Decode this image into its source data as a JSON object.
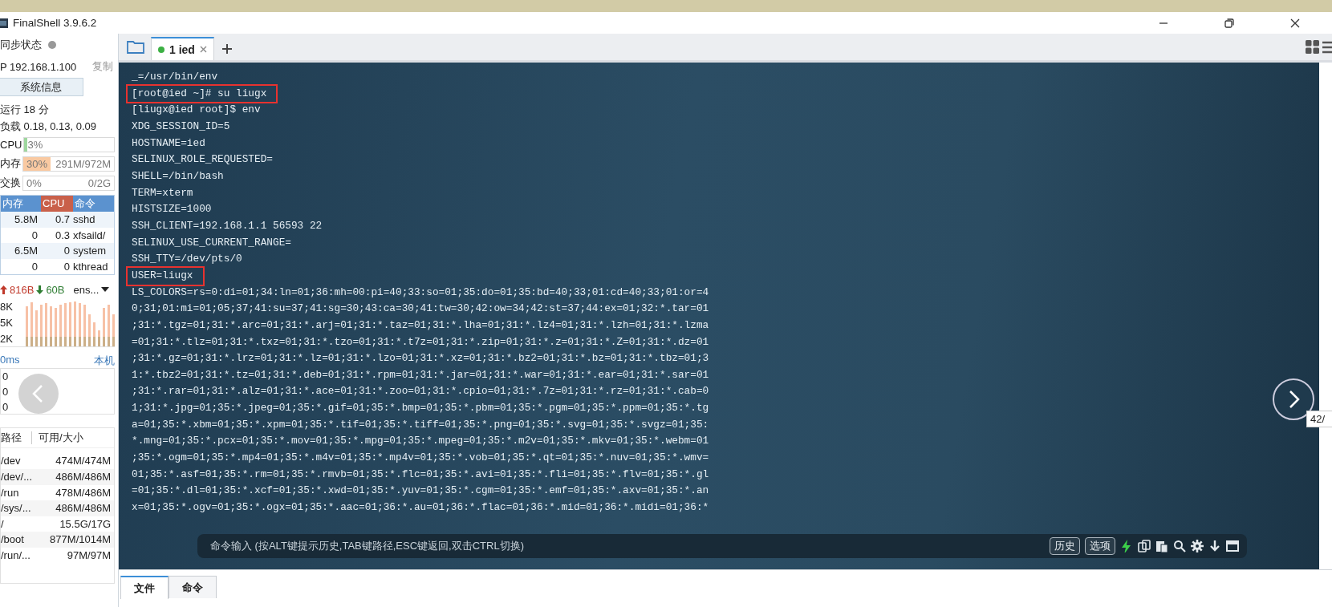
{
  "window": {
    "title": "FinalShell 3.9.6.2"
  },
  "sidebar": {
    "sync_label": "同步状态",
    "sync_on": false,
    "ip": "P 192.168.1.100",
    "copy_link": "复制",
    "sysinfo_button": "系统信息",
    "uptime": "运行 18 分",
    "load": "负载 0.18, 0.13, 0.09",
    "meters": [
      {
        "label": "CPU",
        "level": 0.03,
        "reading": "3%"
      },
      {
        "label": "内存",
        "level": 0.3,
        "reading": "30%",
        "detail": "291M/972M"
      },
      {
        "label": "交换",
        "level": 0,
        "reading": "0%",
        "detail": "0/2G"
      }
    ],
    "process_table": {
      "columns": [
        {
          "label": "内存",
          "selected": false
        },
        {
          "label": "CPU",
          "selected": true
        },
        {
          "label": "命令",
          "selected": false
        }
      ],
      "rows": [
        [
          "5.8M",
          "0.7",
          "sshd"
        ],
        [
          "0",
          "0.3",
          "xfsaild/"
        ],
        [
          "6.5M",
          "0",
          "system"
        ],
        [
          "0",
          "0",
          "kthread"
        ]
      ]
    },
    "network": {
      "up": "816B",
      "down": "60B",
      "interface": "ens...",
      "axis": [
        "8K",
        "5K",
        "2K"
      ]
    },
    "ping": {
      "latency": "0ms",
      "target": "本机",
      "axis": [
        "0",
        "0",
        "0"
      ]
    },
    "disks": {
      "columns": [
        "路径",
        "可用/大小"
      ],
      "rows": [
        [
          "/dev",
          "474M/474M"
        ],
        [
          "/dev/...",
          "486M/486M"
        ],
        [
          "/run",
          "478M/486M"
        ],
        [
          "/sys/...",
          "486M/486M"
        ],
        [
          "/",
          "15.5G/17G"
        ],
        [
          "/boot",
          "877M/1014M"
        ],
        [
          "/run/...",
          "97M/97M"
        ]
      ]
    }
  },
  "tabs": [
    {
      "label": "1 ied",
      "selected": true,
      "connected": true
    }
  ],
  "terminal": {
    "lines": [
      {
        "text": "_=/usr/bin/env",
        "highlighted": false
      },
      {
        "text": "[root@ied ~]# su liugx",
        "highlighted": true
      },
      {
        "text": "[liugx@ied root]$ env",
        "highlighted": false
      },
      {
        "text": "XDG_SESSION_ID=5",
        "highlighted": false
      },
      {
        "text": "HOSTNAME=ied",
        "highlighted": false
      },
      {
        "text": "SELINUX_ROLE_REQUESTED=",
        "highlighted": false
      },
      {
        "text": "SHELL=/bin/bash",
        "highlighted": false
      },
      {
        "text": "TERM=xterm",
        "highlighted": false
      },
      {
        "text": "HISTSIZE=1000",
        "highlighted": false
      },
      {
        "text": "SSH_CLIENT=192.168.1.1 56593 22",
        "highlighted": false
      },
      {
        "text": "SELINUX_USE_CURRENT_RANGE=",
        "highlighted": false
      },
      {
        "text": "SSH_TTY=/dev/pts/0",
        "highlighted": false
      },
      {
        "text": "USER=liugx",
        "highlighted": true
      },
      {
        "text": "LS_COLORS=rs=0:di=01;34:ln=01;36:mh=00:pi=40;33:so=01;35:do=01;35:bd=40;33;01:cd=40;33;01:or=4",
        "highlighted": false
      },
      {
        "text": "0;31;01:mi=01;05;37;41:su=37;41:sg=30;43:ca=30;41:tw=30;42:ow=34;42:st=37;44:ex=01;32:*.tar=01",
        "highlighted": false
      },
      {
        "text": ";31:*.tgz=01;31:*.arc=01;31:*.arj=01;31:*.taz=01;31:*.lha=01;31:*.lz4=01;31:*.lzh=01;31:*.lzma",
        "highlighted": false
      },
      {
        "text": "=01;31:*.tlz=01;31:*.txz=01;31:*.tzo=01;31:*.t7z=01;31:*.zip=01;31:*.z=01;31:*.Z=01;31:*.dz=01",
        "highlighted": false
      },
      {
        "text": ";31:*.gz=01;31:*.lrz=01;31:*.lz=01;31:*.lzo=01;31:*.xz=01;31:*.bz2=01;31:*.bz=01;31:*.tbz=01;3",
        "highlighted": false
      },
      {
        "text": "1:*.tbz2=01;31:*.tz=01;31:*.deb=01;31:*.rpm=01;31:*.jar=01;31:*.war=01;31:*.ear=01;31:*.sar=01",
        "highlighted": false
      },
      {
        "text": ";31:*.rar=01;31:*.alz=01;31:*.ace=01;31:*.zoo=01;31:*.cpio=01;31:*.7z=01;31:*.rz=01;31:*.cab=0",
        "highlighted": false
      },
      {
        "text": "1;31:*.jpg=01;35:*.jpeg=01;35:*.gif=01;35:*.bmp=01;35:*.pbm=01;35:*.pgm=01;35:*.ppm=01;35:*.tg",
        "highlighted": false
      },
      {
        "text": "a=01;35:*.xbm=01;35:*.xpm=01;35:*.tif=01;35:*.tiff=01;35:*.png=01;35:*.svg=01;35:*.svgz=01;35:",
        "highlighted": false
      },
      {
        "text": "*.mng=01;35:*.pcx=01;35:*.mov=01;35:*.mpg=01;35:*.mpeg=01;35:*.m2v=01;35:*.mkv=01;35:*.webm=01",
        "highlighted": false
      },
      {
        "text": ";35:*.ogm=01;35:*.mp4=01;35:*.m4v=01;35:*.mp4v=01;35:*.vob=01;35:*.qt=01;35:*.nuv=01;35:*.wmv=",
        "highlighted": false
      },
      {
        "text": "01;35:*.asf=01;35:*.rm=01;35:*.rmvb=01;35:*.flc=01;35:*.avi=01;35:*.fli=01;35:*.flv=01;35:*.gl",
        "highlighted": false
      },
      {
        "text": "=01;35:*.dl=01;35:*.xcf=01;35:*.xwd=01;35:*.yuv=01;35:*.cgm=01;35:*.emf=01;35:*.axv=01;35:*.an",
        "highlighted": false
      },
      {
        "text": "x=01;35:*.ogv=01;35:*.ogx=01;35:*.aac=01;36:*.au=01;36:*.flac=01;36:*.mid=01;36:*.midi=01;36:*",
        "highlighted": false
      }
    ]
  },
  "command_bar": {
    "placeholder": "命令输入 (按ALT键提示历史,TAB键路径,ESC键返回,双击CTRL切换)",
    "buttons": [
      "历史",
      "选项"
    ]
  },
  "bottom_tabs": [
    {
      "label": "文件",
      "selected": true
    },
    {
      "label": "命令",
      "selected": false
    }
  ],
  "viewer": {
    "counter": "42/"
  }
}
